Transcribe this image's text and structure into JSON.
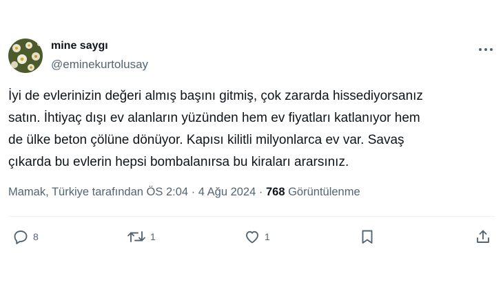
{
  "author": {
    "display_name": "mine saygı",
    "handle": "@eminekurtolusay"
  },
  "tweet": {
    "lines": [
      "İyi de evlerinizin değeri almış başını gitmiş, çok zararda hissediyorsanız",
      "satın. İhtiyaç dışı ev alanların yüzünden hem ev fiyatları katlanıyor hem",
      "de ülke beton çölüne dönüyor. Kapısı kilitli milyonlarca ev var. Savaş",
      "çıkarda bu evlerin hepsi bombalanırsa bu kiraları ararsınız."
    ]
  },
  "meta": {
    "location": "Mamak, Türkiye tarafından",
    "time": "ÖS 2:04",
    "separator": "·",
    "date": "4 Ağu 2024",
    "views_count": "768",
    "views_label": "Görüntülenme"
  },
  "actions": {
    "reply_count": "8",
    "retweet_count": "1",
    "like_count": "1"
  },
  "icons": {
    "more": "more-icon",
    "reply": "reply-icon",
    "retweet": "retweet-icon",
    "like": "heart-icon",
    "bookmark": "bookmark-icon",
    "share": "share-icon"
  },
  "colors": {
    "text": "#0f1419",
    "secondary": "#536471",
    "divider": "#eff3f4"
  }
}
